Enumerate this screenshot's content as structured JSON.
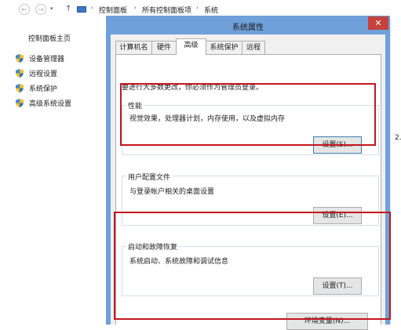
{
  "breadcrumb": {
    "items": [
      "控制面板",
      "所有控制面板项",
      "系统"
    ],
    "separator": "›"
  },
  "nav": {
    "back": "←",
    "forward": "→",
    "up": "↑"
  },
  "left_pane": {
    "home": "控制面板主页",
    "items": [
      {
        "label": "设备管理器",
        "icon": "shield-icon"
      },
      {
        "label": "远程设置",
        "icon": "shield-icon"
      },
      {
        "label": "系统保护",
        "icon": "shield-icon"
      },
      {
        "label": "高级系统设置",
        "icon": "shield-icon"
      }
    ]
  },
  "right_fragment": "2.",
  "dialog": {
    "title": "系统属性",
    "close": "✕",
    "tabs": [
      "计算机名",
      "硬件",
      "高级",
      "系统保护",
      "远程"
    ],
    "active_tab": "高级",
    "notice": "要进行大多数更改，你必须作为管理员登录。",
    "groups": {
      "performance": {
        "title": "性能",
        "desc": "视觉效果，处理器计划，内存使用，以及虚拟内存",
        "button": "设置(S)..."
      },
      "profiles": {
        "title": "用户配置文件",
        "desc": "与登录帐户相关的桌面设置",
        "button": "设置(E)..."
      },
      "startup": {
        "title": "启动和故障恢复",
        "desc": "系统启动、系统故障和调试信息",
        "button": "设置(T)..."
      }
    },
    "env_button": "环境变量(N)..."
  },
  "colors": {
    "dialog_frame": "#6fa0da",
    "close_button": "#c7413b",
    "highlight": "#c4161c",
    "shield_blue": "#2f6fc0",
    "shield_yellow": "#f2c21b"
  }
}
